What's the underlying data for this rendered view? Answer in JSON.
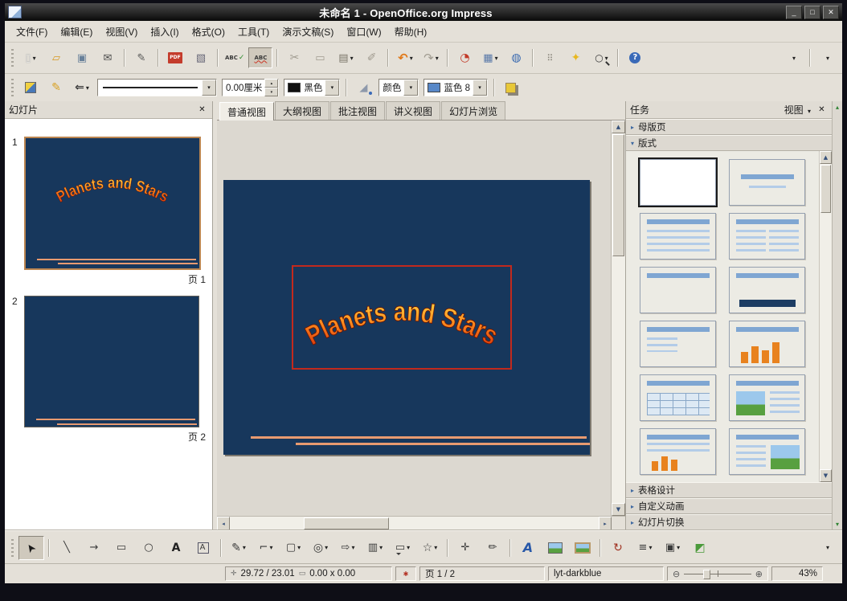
{
  "window": {
    "title": "未命名 1 - OpenOffice.org Impress"
  },
  "menubar": {
    "items": [
      "文件(F)",
      "编辑(E)",
      "视图(V)",
      "插入(I)",
      "格式(O)",
      "工具(T)",
      "演示文稿(S)",
      "窗口(W)",
      "帮助(H)"
    ]
  },
  "toolbar_main": {
    "buttons": [
      {
        "name": "new-document",
        "glyph": "▯",
        "dropdown": true
      },
      {
        "name": "open-folder",
        "glyph": "▱"
      },
      {
        "name": "save",
        "glyph": "▣"
      },
      {
        "name": "send-email",
        "glyph": "✉"
      },
      {
        "sep": true
      },
      {
        "name": "edit-file",
        "glyph": "✎"
      },
      {
        "sep": true
      },
      {
        "name": "export-pdf",
        "glyph": "PDF"
      },
      {
        "name": "print",
        "glyph": "▧"
      },
      {
        "sep": true
      },
      {
        "name": "spellcheck",
        "glyph": "ABC"
      },
      {
        "name": "auto-spellcheck",
        "glyph": "ABC",
        "active": true
      },
      {
        "sep": true
      },
      {
        "name": "cut",
        "glyph": "✂",
        "disabled": true
      },
      {
        "name": "copy",
        "glyph": "▭",
        "disabled": true
      },
      {
        "name": "paste",
        "glyph": "▤",
        "dropdown": true
      },
      {
        "name": "clone-formatting",
        "glyph": "✐",
        "disabled": true
      },
      {
        "sep": true
      },
      {
        "name": "undo",
        "glyph": "↶",
        "dropdown": true
      },
      {
        "name": "redo",
        "glyph": "↷",
        "dropdown": true,
        "disabled": true
      },
      {
        "sep": true
      },
      {
        "name": "chart",
        "glyph": "◔"
      },
      {
        "name": "table",
        "glyph": "▦",
        "dropdown": true
      },
      {
        "name": "hyperlink",
        "glyph": "◍"
      },
      {
        "sep": true
      },
      {
        "name": "display-grid",
        "glyph": "⠿"
      },
      {
        "name": "navigator",
        "glyph": "✦"
      },
      {
        "name": "zoom",
        "glyph": "○",
        "dropdown": true
      },
      {
        "sep": true
      },
      {
        "name": "help",
        "glyph": "?"
      }
    ]
  },
  "toolbar_line": {
    "line_width_value": "0.00厘米",
    "line_color_label": "黑色",
    "fill_type_label": "颜色",
    "fill_color_label": "蓝色 8"
  },
  "view_tabs": {
    "tabs": [
      {
        "label": "普通视图",
        "active": true
      },
      {
        "label": "大纲视图"
      },
      {
        "label": "批注视图"
      },
      {
        "label": "讲义视图"
      },
      {
        "label": "幻灯片浏览"
      }
    ]
  },
  "slides_panel": {
    "title": "幻灯片",
    "slides": [
      {
        "number": "1",
        "caption": "页 1"
      },
      {
        "number": "2",
        "caption": "页 2"
      }
    ]
  },
  "canvas": {
    "slide_title": "Planets and Stars"
  },
  "tasks_panel": {
    "title": "任务",
    "view_menu_label": "视图",
    "sections": {
      "master_pages": "母版页",
      "layouts": "版式",
      "table_design": "表格设计",
      "custom_animation": "自定义动画",
      "slide_transition": "幻灯片切换"
    },
    "layouts": [
      "blank",
      "title-subtitle",
      "title-content",
      "title-two-content",
      "title-only",
      "centered-text",
      "title-content-small",
      "title-chart",
      "title-table",
      "title-clipart-text",
      "title-text-chart",
      "title-text-clipart"
    ],
    "selected_layout": 0
  },
  "drawing_toolbar": {
    "buttons": [
      {
        "name": "select",
        "glyph": "➤",
        "active": true
      },
      {
        "sep": true
      },
      {
        "name": "line",
        "glyph": "╲"
      },
      {
        "name": "arrow",
        "glyph": "→"
      },
      {
        "name": "rectangle",
        "glyph": "▭"
      },
      {
        "name": "ellipse",
        "glyph": "○"
      },
      {
        "name": "text",
        "glyph": "A"
      },
      {
        "name": "vertical-text",
        "glyph": "A"
      },
      {
        "sep": true
      },
      {
        "name": "curve",
        "glyph": "✎",
        "dropdown": true
      },
      {
        "name": "connector",
        "glyph": "⌐",
        "dropdown": true
      },
      {
        "name": "basic-shapes",
        "glyph": "▢",
        "dropdown": true
      },
      {
        "name": "symbol-shapes",
        "glyph": "◎",
        "dropdown": true
      },
      {
        "name": "block-arrows",
        "glyph": "⇨",
        "dropdown": true
      },
      {
        "name": "flowchart",
        "glyph": "▥",
        "dropdown": true
      },
      {
        "name": "callouts",
        "glyph": "▭",
        "dropdown": true
      },
      {
        "name": "stars",
        "glyph": "☆",
        "dropdown": true
      },
      {
        "sep": true
      },
      {
        "name": "edit-points",
        "glyph": "✛"
      },
      {
        "name": "glue-points",
        "glyph": "✏"
      },
      {
        "sep": true
      },
      {
        "name": "fontwork-gallery",
        "glyph": "A"
      },
      {
        "name": "from-file",
        "glyph": ""
      },
      {
        "name": "gallery",
        "glyph": ""
      },
      {
        "sep": true
      },
      {
        "name": "rotate",
        "glyph": "↻"
      },
      {
        "name": "alignment",
        "glyph": "≡",
        "dropdown": true
      },
      {
        "name": "arrange",
        "glyph": "▣",
        "dropdown": true
      },
      {
        "name": "extrusion-on-off",
        "glyph": "◩"
      }
    ]
  },
  "statusbar": {
    "position": "29.72 / 23.01",
    "size": "0.00 x 0.00",
    "page": "页 1 / 2",
    "template": "lyt-darkblue",
    "zoom": "43%"
  },
  "glyphs": {
    "dd": "▾",
    "close": "✕",
    "min": "_",
    "max": "□",
    "up": "▲",
    "down": "▼",
    "left": "◂",
    "right": "▸",
    "scroll_up": "▴",
    "scroll_down": "▾",
    "spin_up": "▴",
    "spin_down": "▾",
    "tri_collapsed": "▸",
    "tri_expanded": "▾",
    "zoom_out": "⊖",
    "zoom_in": "⊕",
    "crosshair": "✛",
    "sizebox": "▭",
    "modified": "✱"
  }
}
